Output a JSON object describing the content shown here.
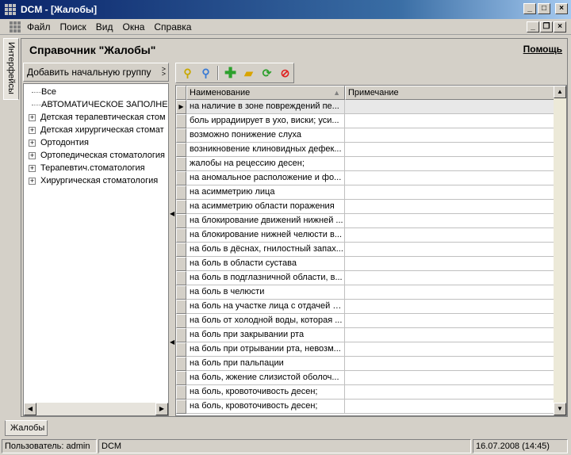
{
  "window": {
    "title": "DCM - [Жалобы]"
  },
  "menu": [
    "Файл",
    "Поиск",
    "Вид",
    "Окна",
    "Справка"
  ],
  "side_tab": {
    "label": "Интерфейсы"
  },
  "page": {
    "title": "Справочник \"Жалобы\"",
    "help": "Помощь"
  },
  "groups": {
    "header": "Добавить начальную группу",
    "items": [
      {
        "label": "Все",
        "expandable": false
      },
      {
        "label": "АВТОМАТИЧЕСКОЕ ЗАПОЛНЕ",
        "expandable": false
      },
      {
        "label": "Детская терапевтическая стом",
        "expandable": true
      },
      {
        "label": "Детская хирургическая стомат",
        "expandable": true
      },
      {
        "label": "Ортодонтия",
        "expandable": true
      },
      {
        "label": "Ортопедическая стоматология",
        "expandable": true
      },
      {
        "label": "Терапевтич.стоматология",
        "expandable": true
      },
      {
        "label": "Хирургическая стоматология",
        "expandable": true
      }
    ]
  },
  "toolbar": {
    "icons": [
      "search-icon",
      "find-user-icon",
      "add-icon",
      "open-folder-icon",
      "refresh-icon",
      "delete-icon"
    ]
  },
  "grid": {
    "columns": [
      "Наименование",
      "Примечание"
    ],
    "rows": [
      " на наличие в зоне повреждений пе...",
      "боль иррадиирует  в ухо, виски; уси...",
      "возможно понижение слуха",
      "возникновение клиновидных дефек...",
      "жалобы на рецессию десен;",
      "на аномальное расположение и фо...",
      "на асимметрию лица",
      "на асимметрию области поражения",
      "на блокирование движений нижней ...",
      "на блокирование нижней челюсти в...",
      "на боль в дёснах, гнилостный запах...",
      "на боль в области сустава",
      "на боль в подглазничной области, в...",
      "на боль в челюсти",
      "на боль на участке лица с отдачей в...",
      "на боль от холодной воды, которая ...",
      "на боль при закрывании рта",
      "на боль при отрывании рта, невозм...",
      "на боль при пальпации",
      "на боль, жжение слизистой оболоч...",
      "на боль, кровоточивость десен;",
      "на боль, кровоточивость десен;"
    ]
  },
  "bottom_tab": {
    "label": "Жалобы"
  },
  "status": {
    "user": "Пользователь: admin",
    "app": "DCM",
    "datetime": "16.07.2008 (14:45)"
  }
}
